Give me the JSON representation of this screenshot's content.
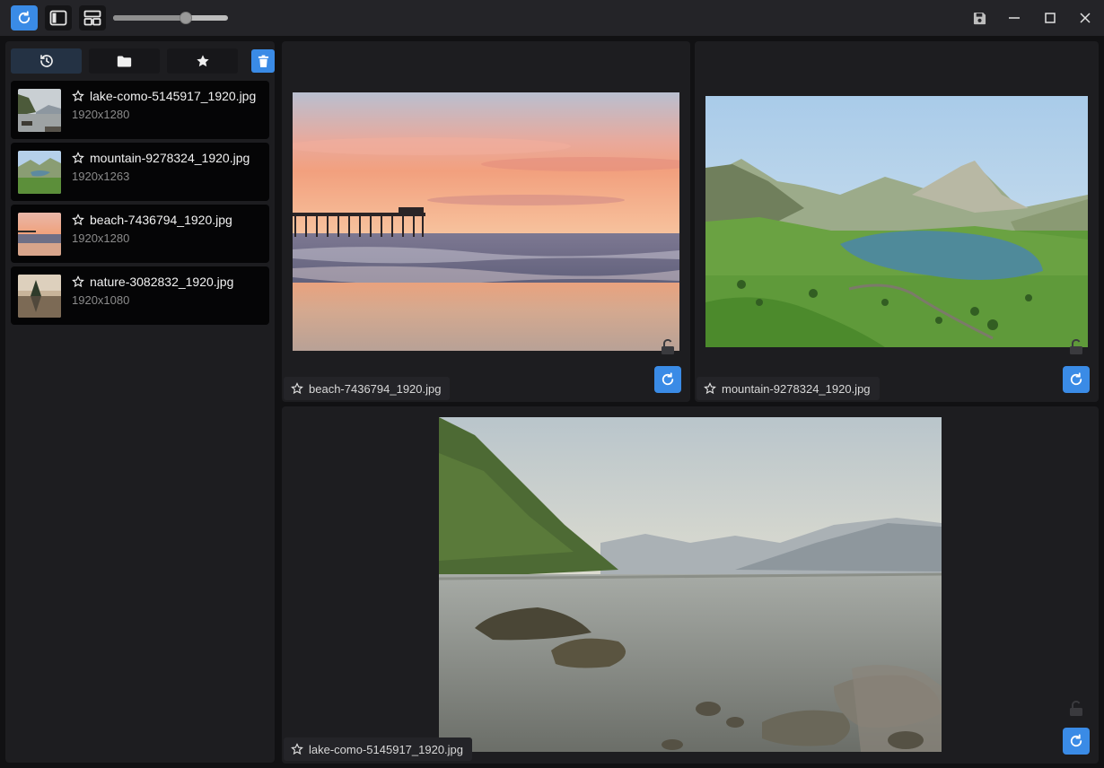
{
  "toolbar": {
    "refresh_icon": "refresh-icon",
    "sidebar_toggle_icon": "sidebar-toggle-icon",
    "layout_icon": "layout-icon",
    "zoom_slider_value": 0.65,
    "save_icon": "save-icon",
    "minimize_icon": "minimize-icon",
    "maximize_icon": "maximize-icon",
    "close_icon": "close-icon"
  },
  "sidebar": {
    "tabs": [
      {
        "icon": "history-icon",
        "active": true
      },
      {
        "icon": "folder-icon",
        "active": false
      },
      {
        "icon": "star-icon",
        "active": false
      }
    ],
    "trash_icon": "trash-icon",
    "files": [
      {
        "name": "lake-como-5145917_1920.jpg",
        "dims": "1920x1280"
      },
      {
        "name": "mountain-9278324_1920.jpg",
        "dims": "1920x1263"
      },
      {
        "name": "beach-7436794_1920.jpg",
        "dims": "1920x1280"
      },
      {
        "name": "nature-3082832_1920.jpg",
        "dims": "1920x1080"
      }
    ]
  },
  "panes": [
    {
      "label": "beach-7436794_1920.jpg"
    },
    {
      "label": "mountain-9278324_1920.jpg"
    },
    {
      "label": "lake-como-5145917_1920.jpg"
    }
  ],
  "colors": {
    "accent": "#3a8be6",
    "background": "#111113",
    "panel": "#1d1d20"
  }
}
